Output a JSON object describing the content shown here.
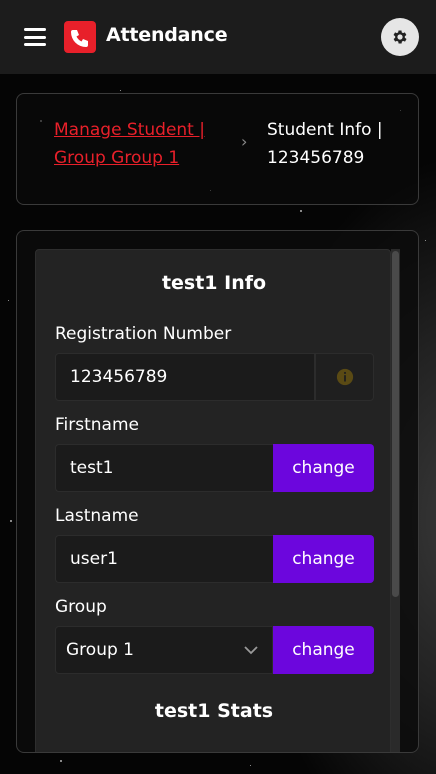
{
  "header": {
    "app_title": "Attendance",
    "menu_icon": "hamburger-menu-icon",
    "logo_icon": "phone-logo-icon",
    "settings_icon": "gear-icon",
    "accent_color": "#e8202a"
  },
  "breadcrumb": {
    "link_label": "Manage Student | Group Group 1",
    "separator": "›",
    "current_label": "Student Info | 123456789"
  },
  "student_info": {
    "title": "test1 Info",
    "registration": {
      "label": "Registration Number",
      "value": "123456789",
      "addon_icon": "info-icon"
    },
    "firstname": {
      "label": "Firstname",
      "value": "test1",
      "button_label": "change"
    },
    "lastname": {
      "label": "Lastname",
      "value": "user1",
      "button_label": "change"
    },
    "group": {
      "label": "Group",
      "selected": "Group 1",
      "button_label": "change"
    },
    "button_color": "#6c06dd"
  },
  "stats": {
    "title": "test1 Stats"
  }
}
